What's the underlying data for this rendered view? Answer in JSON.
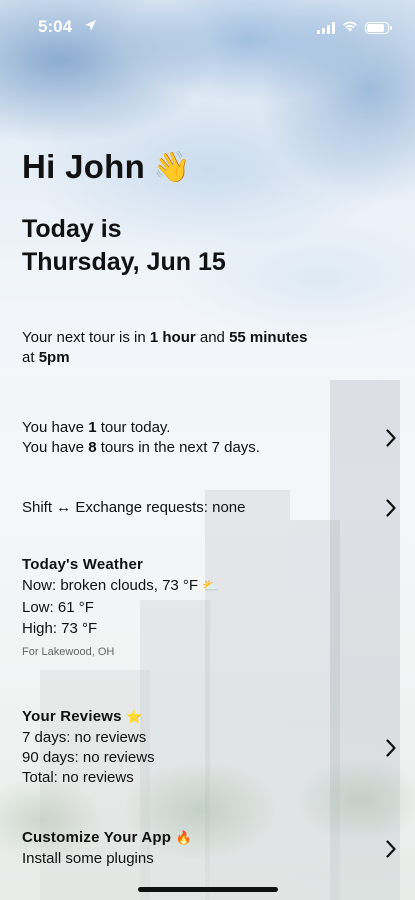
{
  "status_bar": {
    "time": "5:04"
  },
  "greeting": {
    "text": "Hi John",
    "emoji": "👋"
  },
  "today": {
    "line1": "Today is",
    "line2": "Thursday, Jun 15"
  },
  "next_tour": {
    "prefix": "Your next tour is in ",
    "hours": "1 hour",
    "middle": " and ",
    "minutes": "55 minutes",
    "at_prefix": "at ",
    "time": "5pm"
  },
  "tours_summary": {
    "line1_prefix": "You have ",
    "today_count": "1",
    "line1_suffix": " tour today.",
    "line2_prefix": "You have ",
    "week_count": "8",
    "line2_suffix": " tours in the next 7 days."
  },
  "shift_exchange": {
    "label": "Shift ↔ Exchange requests: none"
  },
  "weather": {
    "title": "Today's Weather",
    "now": "Now: broken clouds, 73 °F",
    "now_emoji": "⛅",
    "low": "Low: 61 °F",
    "high": "High: 73 °F",
    "location": "For Lakewood, OH"
  },
  "reviews": {
    "title": "Your Reviews",
    "title_emoji": "⭐",
    "days7": "7 days: no reviews",
    "days90": "90 days: no reviews",
    "total": "Total: no reviews"
  },
  "customize": {
    "title": "Customize Your App",
    "title_emoji": "🔥",
    "subtitle": "Install some plugins"
  }
}
